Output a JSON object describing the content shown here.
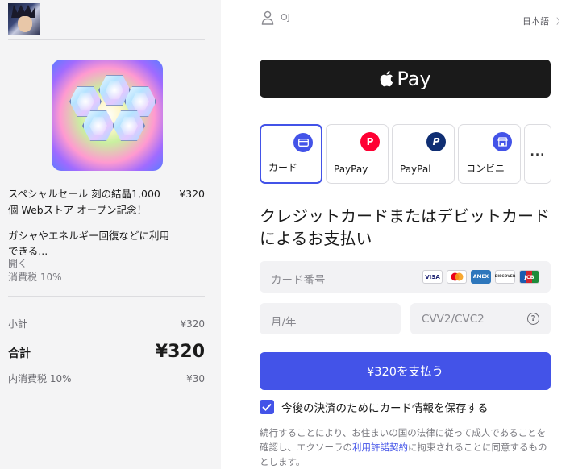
{
  "order": {
    "product_title": "スペシャルセール 刻の結晶1,000個 Webストア オープン記念！",
    "product_price": "¥320",
    "product_description": "ガシャやエネルギー回復などに利用できる...",
    "more_link": "開く",
    "tax_note": "消費税 10%",
    "subtotal_label": "小計",
    "subtotal_value": "¥320",
    "total_label": "合計",
    "total_value": "¥320",
    "included_tax_label": "内消費税 10%",
    "included_tax_value": "¥30"
  },
  "header": {
    "user_name": "OJ",
    "language": "日本語"
  },
  "apple_pay": {
    "label": "Pay"
  },
  "payment_methods": [
    {
      "label": "カード",
      "icon": "card-icon",
      "color": "#4353e8",
      "selected": true
    },
    {
      "label": "PayPay",
      "icon": "paypay-icon",
      "color": "#ff0033",
      "selected": false
    },
    {
      "label": "PayPal",
      "icon": "paypal-icon",
      "color": "#0f2e73",
      "selected": false
    },
    {
      "label": "コンビニ",
      "icon": "store-icon",
      "color": "#4353e8",
      "selected": false
    }
  ],
  "more_methods_label": "...",
  "form": {
    "heading": "クレジットカードまたはデビットカードによるお支払い",
    "card_number_placeholder": "カード番号",
    "expiry_placeholder": "月/年",
    "cvv_placeholder": "CVV2/CVC2",
    "card_brands": [
      "VISA",
      "mastercard",
      "AMEX",
      "DISCOVER",
      "JCB"
    ]
  },
  "pay_button_label": "¥320を支払う",
  "save_card_label": "今後の決済のためにカード情報を保存する",
  "legal": {
    "text_before": "続行することにより、お住まいの国の法律に従って成人であることを確認し、エクソーラの",
    "link_text": "利用許諾契約",
    "text_after": "に拘束されることに同意するものとします。"
  },
  "colors": {
    "accent": "#4353e8",
    "apple_pay_bg": "#1a1a1a",
    "left_panel_bg": "#f4f4f5"
  }
}
